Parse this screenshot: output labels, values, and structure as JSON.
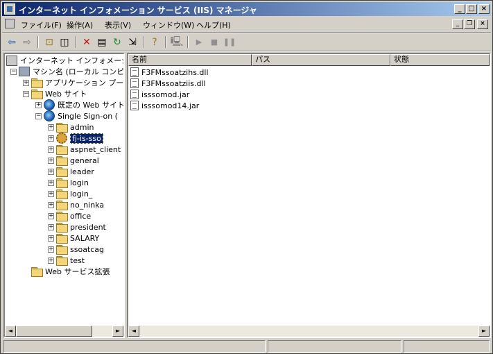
{
  "window": {
    "title": "インターネット インフォメーション サービス (IIS) マネージャ",
    "minimize": "_",
    "maximize": "□",
    "close": "×"
  },
  "menu": {
    "items": [
      "ファイル(F)",
      "操作(A)",
      "表示(V)",
      "ウィンドウ(W)",
      "ヘルプ(H)"
    ]
  },
  "toolbar": {
    "icons": [
      "back-arrow-icon",
      "forward-arrow-icon",
      "up-folder-icon",
      "show-tree-icon",
      "delete-icon",
      "properties-icon",
      "refresh-icon",
      "export-icon",
      "help-icon",
      "computer-icon",
      "play-icon",
      "stop-icon",
      "pause-icon"
    ]
  },
  "tree": {
    "root": "インターネット インフォメーション",
    "machine": "マシン名 (ローカル コンピ",
    "app_pools": "アプリケーション プール",
    "web_sites": "Web サイト",
    "default_site": "既定の Web サイト",
    "sso_site": "Single Sign-on (",
    "children": [
      "admin",
      "fj-is-sso",
      "aspnet_client",
      "general",
      "leader",
      "login",
      "login_",
      "no_ninka",
      "office",
      "president",
      "SALARY",
      "ssoatcag",
      "test"
    ],
    "web_ext": "Web サービス拡張"
  },
  "list": {
    "columns": [
      "名前",
      "パス",
      "状態"
    ],
    "files": [
      "F3FMssoatzihs.dll",
      "F3FMssoatziis.dll",
      "isssomod.jar",
      "isssomod14.jar"
    ]
  },
  "scroll": {
    "left": "◄",
    "right": "►"
  }
}
